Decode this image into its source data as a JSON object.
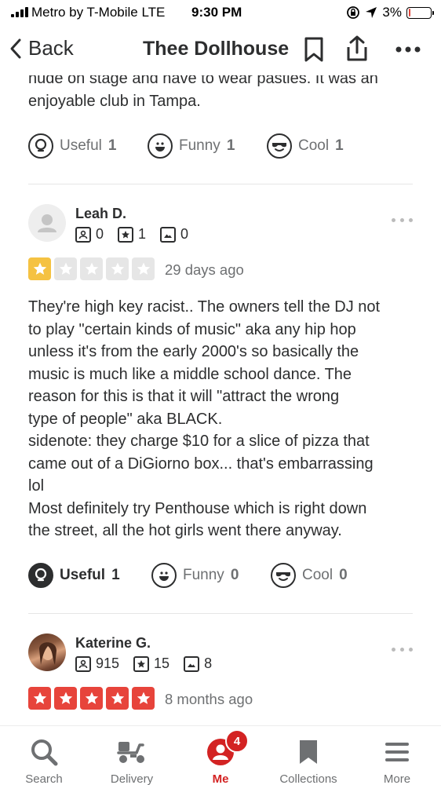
{
  "status_bar": {
    "carrier": "Metro by T-Mobile",
    "network": "LTE",
    "time": "9:30 PM",
    "battery_percent": "3%",
    "battery_level": 0.03,
    "icons": [
      "signal-icon",
      "screen-rotation-lock-icon",
      "location-arrow-icon",
      "battery-icon"
    ]
  },
  "nav": {
    "back_label": "Back",
    "title": "Thee Dollhouse",
    "icons": [
      "chevron-left-icon",
      "bookmark-icon",
      "share-icon",
      "more-icon"
    ]
  },
  "previous_review": {
    "text_tail": "nude on stage and have to wear pasties. It was an\nenjoyable club in Tampa.",
    "actions": [
      {
        "label": "Useful",
        "count": "1",
        "icon": "lightbulb-icon",
        "active": false
      },
      {
        "label": "Funny",
        "count": "1",
        "icon": "smile-icon",
        "active": false
      },
      {
        "label": "Cool",
        "count": "1",
        "icon": "sunglasses-icon",
        "active": false
      }
    ]
  },
  "reviews": [
    {
      "user_name": "Leah D.",
      "friends": "0",
      "reviews": "1",
      "photos": "0",
      "rating": 1,
      "date": "29 days ago",
      "text": "They're high key racist.. The owners tell the DJ not\nto play \"certain kinds of music\" aka any hip hop\nunless it's from the early 2000's so basically the\nmusic is much like a middle school dance. The\nreason for this is that it will \"attract the wrong\ntype of people\" aka BLACK.\nsidenote: they charge $10 for a slice of pizza that\ncame out of a DiGiorno box... that's embarrassing\nlol\nMost definitely try Penthouse which is right down\nthe street, all the hot girls went there anyway.",
      "actions": [
        {
          "label": "Useful",
          "count": "1",
          "icon": "lightbulb-icon",
          "active": true
        },
        {
          "label": "Funny",
          "count": "0",
          "icon": "smile-icon",
          "active": false
        },
        {
          "label": "Cool",
          "count": "0",
          "icon": "sunglasses-icon",
          "active": false
        }
      ]
    },
    {
      "user_name": "Katerine G.",
      "friends": "915",
      "reviews": "15",
      "photos": "8",
      "rating": 5,
      "date": "8 months ago"
    }
  ],
  "colors": {
    "star_yellow": "#f5c242",
    "star_red": "#e7443b",
    "brand_red": "#d32323",
    "text_dark": "#2d2e2f"
  },
  "tabbar": {
    "tabs": [
      {
        "label": "Search",
        "icon": "search-icon"
      },
      {
        "label": "Delivery",
        "icon": "delivery-scooter-icon"
      },
      {
        "label": "Me",
        "icon": "profile-icon",
        "badge": "4",
        "active": true
      },
      {
        "label": "Collections",
        "icon": "bookmark-icon"
      },
      {
        "label": "More",
        "icon": "menu-icon"
      }
    ]
  }
}
